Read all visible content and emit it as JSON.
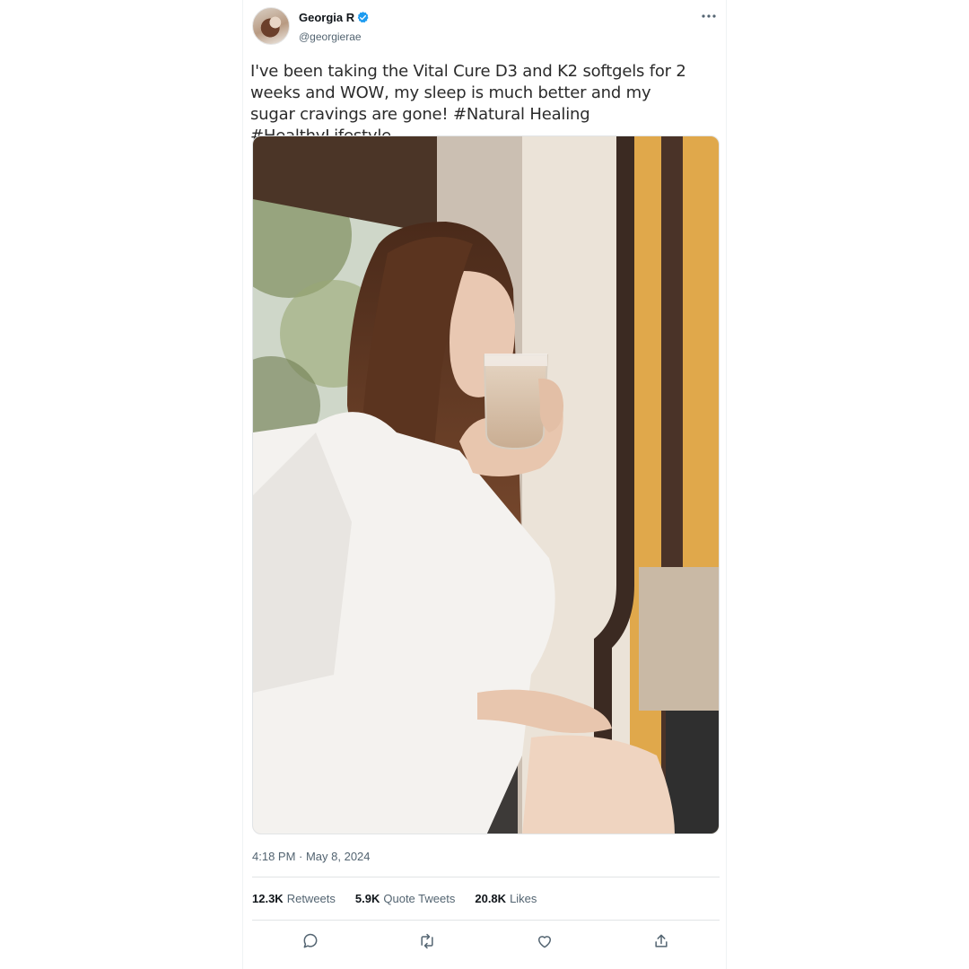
{
  "tweet": {
    "author": {
      "display_name": "Georgia R",
      "handle": "@georgierae",
      "verified": true
    },
    "text": "I've been taking the Vital Cure D3 and K2 softgels for 2 weeks and WOW, my sleep is much better and my sugar cravings are gone! #Natural Healing #HealthyLifestyle",
    "timestamp": "4:18 PM · May 8, 2024",
    "stats": {
      "retweets_value": "12.3K",
      "retweets_label": "Retweets",
      "quote_tweets_value": "5.9K",
      "quote_tweets_label": "Quote Tweets",
      "likes_value": "20.8K",
      "likes_label": "Likes"
    }
  },
  "icons": {
    "verified": "verified-badge-icon",
    "more": "more-dots-icon",
    "reply": "reply-icon",
    "retweet": "retweet-icon",
    "like": "heart-icon",
    "share": "share-icon"
  },
  "colors": {
    "verified_blue": "#1d9bf0",
    "secondary_text": "#536471",
    "divider": "#e1e4e6"
  }
}
